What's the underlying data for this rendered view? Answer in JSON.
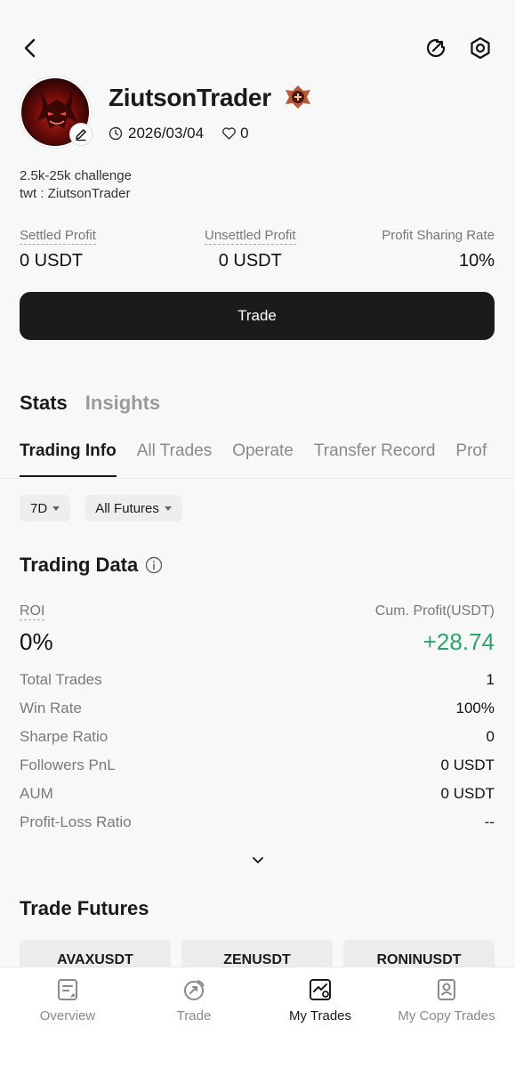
{
  "header": {
    "back_icon": "chevron-left-icon",
    "share_icon": "share-refresh-icon",
    "settings_icon": "hexagon-gear-icon"
  },
  "profile": {
    "name": "ZiutsonTrader",
    "date": "2026/03/04",
    "likes": "0",
    "bio_line1": "2.5k-25k challenge",
    "bio_line2": "twt : ZiutsonTrader"
  },
  "metrics": {
    "settled_label": "Settled Profit",
    "settled_value": "0 USDT",
    "unsettled_label": "Unsettled Profit",
    "unsettled_value": "0 USDT",
    "sharing_label": "Profit Sharing Rate",
    "sharing_value": "10%"
  },
  "trade_button": "Trade",
  "main_tabs": {
    "stats": "Stats",
    "insights": "Insights"
  },
  "sub_tabs": [
    "Trading Info",
    "All Trades",
    "Operate",
    "Transfer Record",
    "Prof"
  ],
  "filters": {
    "period": "7D",
    "market": "All Futures"
  },
  "trading_data": {
    "title": "Trading Data",
    "roi_label": "ROI",
    "roi_value": "0%",
    "cum_label": "Cum. Profit(USDT)",
    "cum_value": "+28.74",
    "rows": [
      {
        "k": "Total Trades",
        "v": "1"
      },
      {
        "k": "Win Rate",
        "v": "100%"
      },
      {
        "k": "Sharpe Ratio",
        "v": "0"
      },
      {
        "k": "Followers PnL",
        "v": "0 USDT"
      },
      {
        "k": "AUM",
        "v": "0 USDT"
      },
      {
        "k": "Profit-Loss Ratio",
        "v": "--"
      }
    ]
  },
  "trade_futures": {
    "title": "Trade Futures",
    "pairs": [
      "AVAXUSDT",
      "ZENUSDT",
      "RONINUSDT"
    ]
  },
  "bottom_nav": {
    "overview": "Overview",
    "trade": "Trade",
    "my_trades": "My Trades",
    "my_copy_trades": "My Copy Trades"
  },
  "colors": {
    "accent_green": "#2fa36b",
    "button_dark": "#1b1b1b"
  }
}
